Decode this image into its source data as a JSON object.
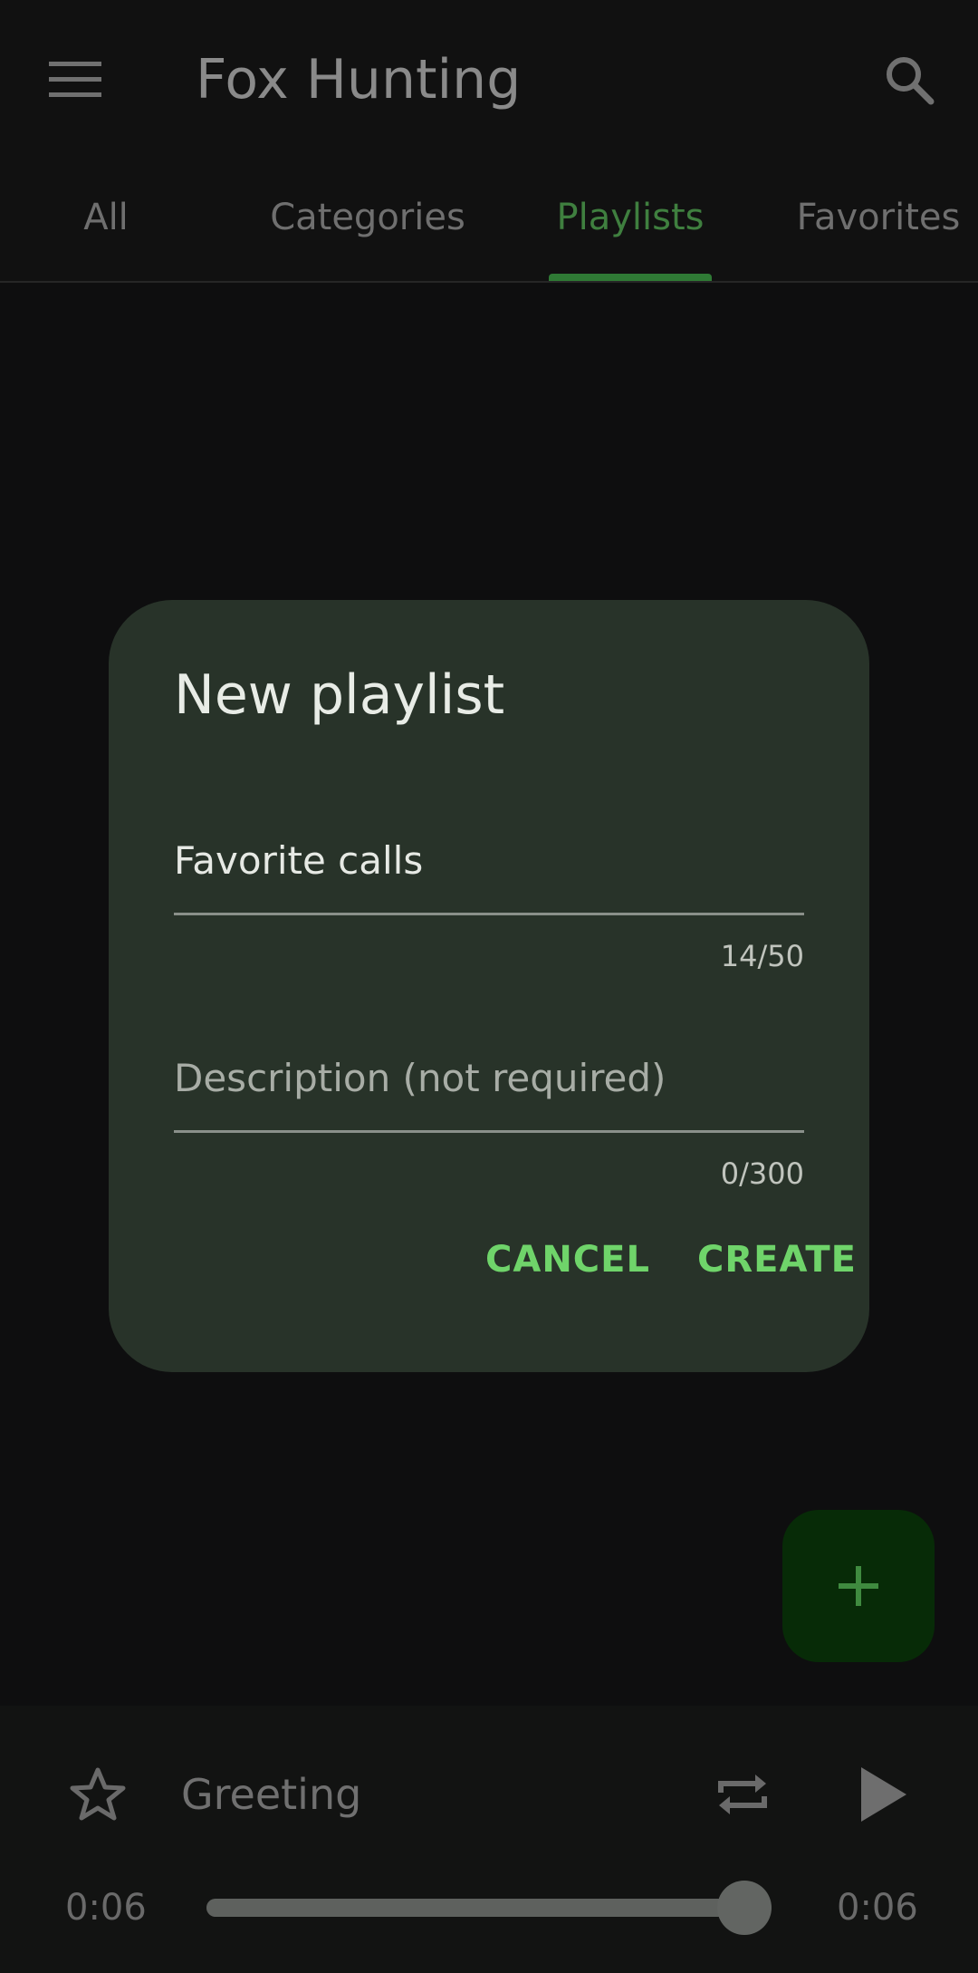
{
  "app": {
    "title": "Fox Hunting"
  },
  "tabs": [
    {
      "label": "All"
    },
    {
      "label": "Categories"
    },
    {
      "label": "Playlists"
    },
    {
      "label": "Favorites"
    }
  ],
  "active_tab": "Playlists",
  "icons": {
    "menu": "menu-icon",
    "search": "search-icon",
    "add": "plus-icon",
    "favorite": "star-outline-icon",
    "repeat": "repeat-icon",
    "play": "play-icon"
  },
  "player": {
    "track_title": "Greeting",
    "time_elapsed": "0:06",
    "time_total": "0:06",
    "progress": 1.0
  },
  "dialog": {
    "title": "New playlist",
    "name_value": "Favorite calls",
    "name_counter": "14/50",
    "description_placeholder": "Description (not required)",
    "description_value": "",
    "description_counter": "0/300",
    "cancel_label": "CANCEL",
    "create_label": "CREATE"
  },
  "colors": {
    "accent": "#6fd46a",
    "tab_active": "#3f7f3f",
    "dialog_background": "#283329",
    "fab_background": "#072b07"
  }
}
